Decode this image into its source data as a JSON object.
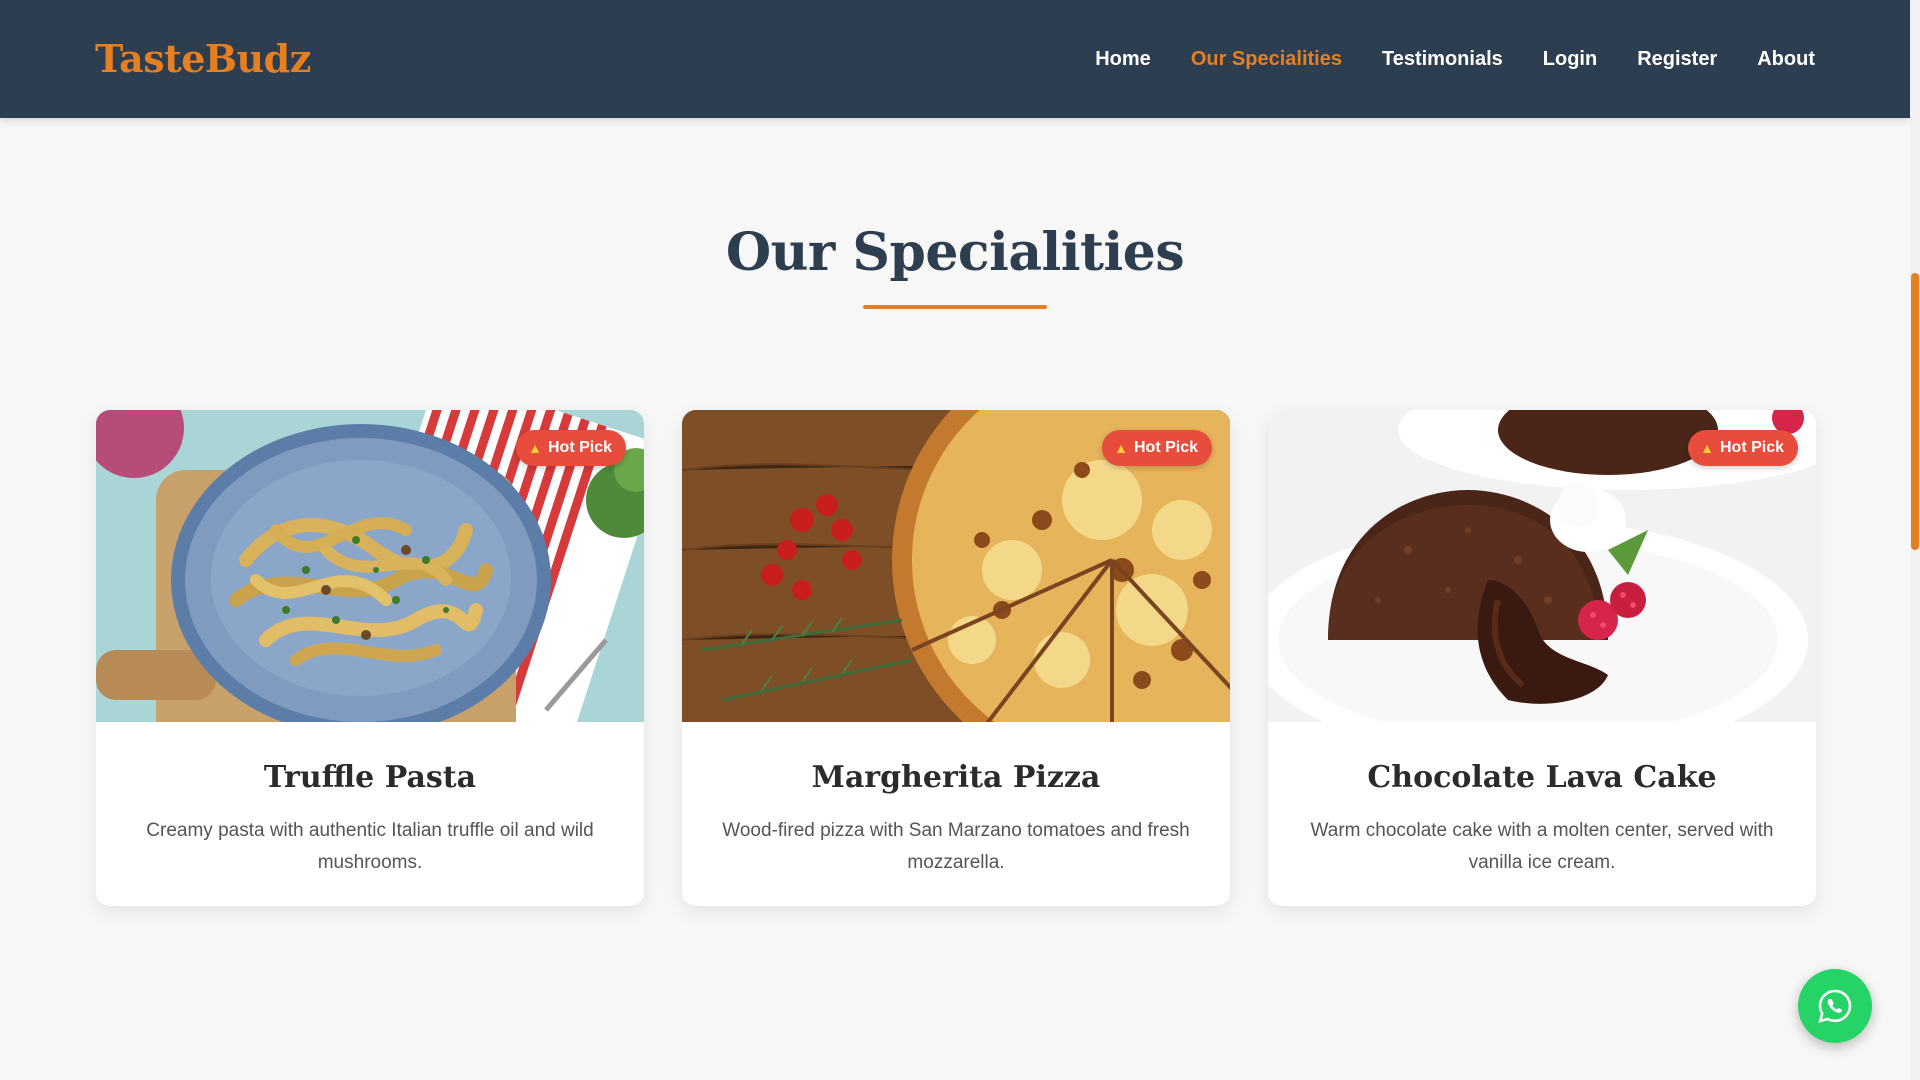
{
  "brand": {
    "name": "TasteBudz"
  },
  "nav": {
    "items": [
      {
        "label": "Home",
        "active": false
      },
      {
        "label": "Our Specialities",
        "active": true
      },
      {
        "label": "Testimonials",
        "active": false
      },
      {
        "label": "Login",
        "active": false
      },
      {
        "label": "Register",
        "active": false
      },
      {
        "label": "About",
        "active": false
      }
    ]
  },
  "section": {
    "title": "Our Specialities"
  },
  "cards": [
    {
      "badge": "Hot Pick",
      "title": "Truffle Pasta",
      "description": "Creamy pasta with authentic Italian truffle oil and wild mushrooms."
    },
    {
      "badge": "Hot Pick",
      "title": "Margherita Pizza",
      "description": "Wood-fired pizza with San Marzano tomatoes and fresh mozzarella."
    },
    {
      "badge": "Hot Pick",
      "title": "Chocolate Lava Cake",
      "description": "Warm chocolate cake with a molten center, served with vanilla ice cream."
    }
  ],
  "icons": {
    "badge": "flame-icon",
    "floating_button": "whatsapp-icon"
  },
  "colors": {
    "header_bg": "#2c3e50",
    "accent": "#e67e22",
    "nav_text": "#ffffff",
    "title_text": "#2c3e50",
    "badge_bg": "#e74c3c",
    "whatsapp": "#25d366"
  }
}
